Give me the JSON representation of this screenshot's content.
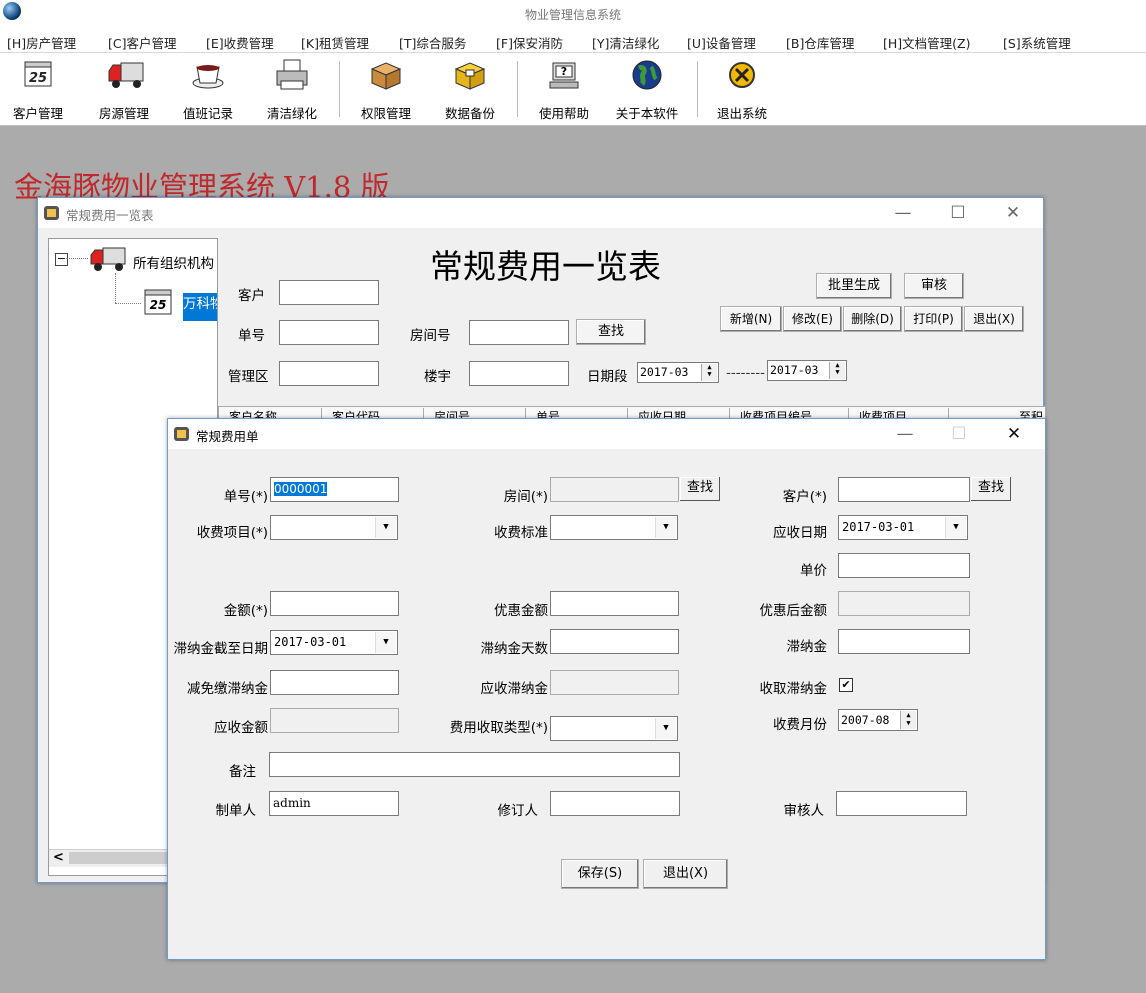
{
  "app": {
    "title": "物业管理信息系统",
    "brand_title": "金海豚物业管理系统 V1.8 版"
  },
  "menu": [
    "[H]房产管理",
    "[C]客户管理",
    "[E]收费管理",
    "[K]租赁管理",
    "[T]综合服务",
    "[F]保安消防",
    "[Y]清洁绿化",
    "[U]设备管理",
    "[B]仓库管理",
    "[H]文档管理(Z)",
    "[S]系统管理"
  ],
  "toolbar": {
    "customer": "客户管理",
    "house": "房源管理",
    "duty": "值班记录",
    "cleaning": "清洁绿化",
    "permission": "权限管理",
    "backup": "数据备份",
    "help": "使用帮助",
    "about": "关于本软件",
    "exit": "退出系统",
    "calendar_day": "25"
  },
  "list_window": {
    "title": "常规费用一览表",
    "heading": "常规费用一览表",
    "tree_root": "所有组织机构",
    "tree_child": "万科物",
    "calendar_day": "25",
    "labels": {
      "customer": "客户",
      "order_no": "单号",
      "room_no": "房间号",
      "area": "管理区",
      "building": "楼宇",
      "date_range": "日期段",
      "dash": "--------"
    },
    "date_from": "2017-03",
    "date_to": "2017-03",
    "buttons": {
      "find": "查找",
      "batch": "批里生成",
      "audit": "审核",
      "add": "新增(N)",
      "edit": "修改(E)",
      "delete": "删除(D)",
      "print": "打印(P)",
      "exit": "退出(X)"
    },
    "columns": [
      "客户名称",
      "客户代码",
      "房间号",
      "单号",
      "应收日期",
      "收费项目编号",
      "收费项目",
      "至积"
    ],
    "scroll_left": "<"
  },
  "form_window": {
    "title": "常规费用单",
    "fields": {
      "order_no": {
        "label": "单号(*)",
        "value": "0000001"
      },
      "room": {
        "label": "房间(*)",
        "value": ""
      },
      "customer": {
        "label": "客户(*)",
        "value": ""
      },
      "charge_item": {
        "label": "收费项目(*)",
        "value": ""
      },
      "charge_standard": {
        "label": "收费标准",
        "value": ""
      },
      "due_date": {
        "label": "应收日期",
        "value": "2017-03-01"
      },
      "unit_price": {
        "label": "单价",
        "value": ""
      },
      "amount": {
        "label": "金额(*)",
        "value": ""
      },
      "discount": {
        "label": "优惠金额",
        "value": ""
      },
      "after_discount": {
        "label": "优惠后金额",
        "value": ""
      },
      "late_fee_until": {
        "label": "滞纳金截至日期",
        "value": "2017-03-01"
      },
      "late_fee_days": {
        "label": "滞纳金天数",
        "value": ""
      },
      "late_fee": {
        "label": "滞纳金",
        "value": ""
      },
      "late_fee_waived": {
        "label": "减免缴滞纳金",
        "value": ""
      },
      "late_fee_due": {
        "label": "应收滞纳金",
        "value": ""
      },
      "collect_late_fee": {
        "label": "收取滞纳金",
        "checked": true
      },
      "receivable": {
        "label": "应收金额",
        "value": ""
      },
      "fee_type": {
        "label": "费用收取类型(*)",
        "value": ""
      },
      "billing_month": {
        "label": "收费月份",
        "value": "2007-08"
      },
      "remark": {
        "label": "备注",
        "value": ""
      },
      "creator": {
        "label": "制单人",
        "value": "admin"
      },
      "reviser": {
        "label": "修订人",
        "value": ""
      },
      "auditor": {
        "label": "审核人",
        "value": ""
      }
    },
    "buttons": {
      "find_room": "查找",
      "find_customer": "查找",
      "save": "保存(S)",
      "exit": "退出(X)"
    },
    "checkmark": "✔"
  }
}
